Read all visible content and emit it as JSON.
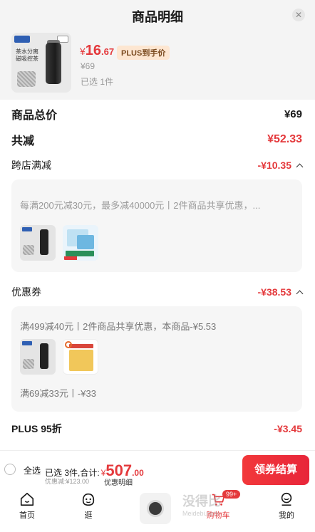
{
  "header": {
    "title": "商品明细",
    "close_icon": "close-icon"
  },
  "product": {
    "thumb_text": "茶水分离 磁吸控茶",
    "price_symbol": "¥",
    "price_int": "16",
    "price_dec": ".67",
    "plus_badge": "PLUS到手价",
    "original_price": "¥69",
    "selected": "已选 1件"
  },
  "summary": {
    "total_label": "商品总价",
    "total_value": "¥69",
    "reduce_label": "共减",
    "reduce_value": "¥52.33"
  },
  "cross_store": {
    "label": "跨店满减",
    "value": "-¥10.35",
    "desc": "每满200元减30元，最多减40000元丨2件商品共享优惠，..."
  },
  "coupon": {
    "label": "优惠券",
    "value": "-¥38.53",
    "desc1": "满499减40元丨2件商品共享优惠，本商品-¥5.53",
    "desc2": "满69减33元丨-¥33"
  },
  "plus": {
    "label": "PLUS 95折",
    "value": "-¥3.45"
  },
  "bottom": {
    "select_all": "全选",
    "selected_total_prefix": "已选 3件,合计:",
    "total_symbol": "¥",
    "total_int": "507",
    "total_dec": ".00",
    "discount": "优惠减:¥123.00",
    "detail": "优惠明细",
    "checkout": "领券结算"
  },
  "tabs": [
    {
      "label": "首页",
      "icon": "home-icon"
    },
    {
      "label": "逛",
      "icon": "browse-icon"
    },
    {
      "label": "",
      "icon": "washer-product-icon"
    },
    {
      "label": "购物车",
      "icon": "cart-icon",
      "badge": "99+"
    },
    {
      "label": "我的",
      "icon": "profile-icon"
    }
  ],
  "watermark": {
    "main": "没得比",
    "sub": "Meidebi.com"
  },
  "colors": {
    "accent": "#e4393c",
    "plus_bg": "#fde6d1"
  }
}
